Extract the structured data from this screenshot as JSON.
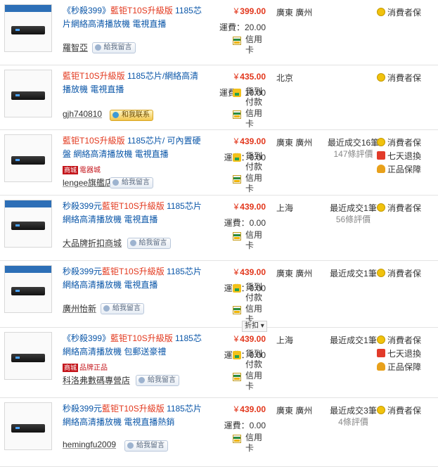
{
  "listings": [
    {
      "title_parts": [
        {
          "t": "《秒殺399》",
          "hl": false
        },
        {
          "t": "藍钜T10S升級版",
          "hl": true
        },
        {
          "t": " 1185芯片網絡高清播放機 電視直播",
          "hl": false
        }
      ],
      "seller": "羅智亞",
      "msg_label": "給我留言",
      "msg_type": "msg",
      "currency": "¥",
      "price": "399.00",
      "shipping": "運費：20.00",
      "pay": [
        "card"
      ],
      "pay_labels": {
        "card": "信用卡",
        "cod": "貨到付款"
      },
      "location": "廣東 廣州",
      "sold": "",
      "reviews": "",
      "services": [
        "消費者保"
      ]
    },
    {
      "title_parts": [
        {
          "t": "藍钜T10S升級版",
          "hl": true
        },
        {
          "t": " 1185芯片/網絡高清播放機 電視直播",
          "hl": false
        }
      ],
      "seller": "gjh740810",
      "msg_label": "和我联系",
      "msg_type": "contact",
      "currency": "¥",
      "price": "435.00",
      "shipping": "運費：10.00",
      "pay": [
        "cod",
        "card"
      ],
      "location": "北京",
      "sold": "",
      "reviews": "",
      "services": [
        "消費者保"
      ]
    },
    {
      "title_parts": [
        {
          "t": "藍钜T10S升級版",
          "hl": true
        },
        {
          "t": " 1185芯片/ 可內置硬盤 網絡高清播放機 電視直播",
          "hl": false
        }
      ],
      "badge": "商城",
      "badge_label": "電器城",
      "seller": "lengee旗艦店",
      "msg_label": "給我留言",
      "msg_type": "msg",
      "currency": "¥",
      "price": "439.00",
      "shipping": "運費：0.00",
      "pay": [
        "cod",
        "card"
      ],
      "location": "廣東 廣州",
      "sold": "最近成交16筆",
      "reviews": "147條評價",
      "services": [
        "消費者保",
        "七天退換",
        "正品保障"
      ]
    },
    {
      "title_parts": [
        {
          "t": "秒殺399元",
          "hl": false
        },
        {
          "t": "藍钜T10S升級版",
          "hl": true
        },
        {
          "t": " 1185芯片 網絡高清播放機 電視直播",
          "hl": false
        }
      ],
      "seller": "大品牌折扣商城",
      "msg_label": "給我留言",
      "msg_type": "msg",
      "currency": "¥",
      "price": "439.00",
      "shipping": "運費：0.00",
      "pay": [
        "card"
      ],
      "location": "上海",
      "sold": "最近成交1筆",
      "reviews": "56條評價",
      "services": [
        "消費者保"
      ]
    },
    {
      "title_parts": [
        {
          "t": "秒殺399元",
          "hl": false
        },
        {
          "t": "藍钜T10S升級版",
          "hl": true
        },
        {
          "t": " 1185芯片 網絡高清播放機 電視直播",
          "hl": false
        }
      ],
      "seller": "廣州怡新",
      "msg_label": "給我留言",
      "msg_type": "msg",
      "currency": "¥",
      "price": "439.00",
      "shipping": "運費：0.00",
      "pay": [
        "cod",
        "card"
      ],
      "location": "廣東 廣州",
      "sold": "最近成交1筆",
      "reviews": "",
      "services": [
        "消費者保"
      ],
      "fold_label": "折扣 ▾"
    },
    {
      "title_parts": [
        {
          "t": "《秒殺399》",
          "hl": false
        },
        {
          "t": "藍钜T10S升級版",
          "hl": true
        },
        {
          "t": " 1185芯 網絡高清播放機 包郵送豪禮",
          "hl": false
        }
      ],
      "badge": "商城",
      "badge_label": "品牌正品",
      "seller": "科洛弗數碼專營店",
      "msg_label": "給我留言",
      "msg_type": "msg",
      "currency": "¥",
      "price": "439.00",
      "shipping": "運費：0.00",
      "pay": [
        "cod",
        "card"
      ],
      "location": "上海",
      "sold": "最近成交1筆",
      "reviews": "",
      "services": [
        "消費者保",
        "七天退換",
        "正品保障"
      ]
    },
    {
      "title_parts": [
        {
          "t": "秒殺399元",
          "hl": false
        },
        {
          "t": "藍钜T10S升級版",
          "hl": true
        },
        {
          "t": " 1185芯片 網絡高清播放機 電視直播熱銷",
          "hl": false
        }
      ],
      "seller": "hemingfu2009",
      "msg_label": "給我留言",
      "msg_type": "msg",
      "currency": "¥",
      "price": "439.00",
      "shipping": "運費：0.00",
      "pay": [
        "card"
      ],
      "location": "廣東 廣州",
      "sold": "最近成交3筆",
      "reviews": "4條評價",
      "services": [
        "消費者保"
      ]
    }
  ]
}
